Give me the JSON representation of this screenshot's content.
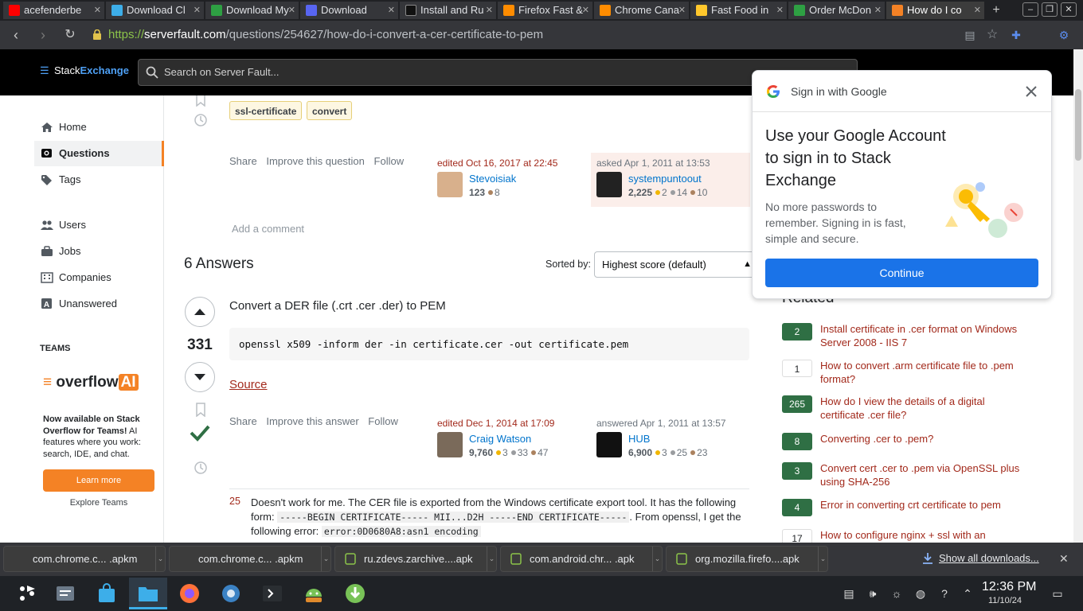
{
  "browser": {
    "tabs": [
      {
        "label": "acefenderbe",
        "color": "#ff0000"
      },
      {
        "label": "Download Cl",
        "color": "#3daee9"
      },
      {
        "label": "Download My",
        "color": "#2ea043"
      },
      {
        "label": "Download",
        "color": "#5865f2"
      },
      {
        "label": "Install and Ru",
        "color": "#111111"
      },
      {
        "label": "Firefox Fast &",
        "color": "#ff8c00"
      },
      {
        "label": "Chrome Cana",
        "color": "#ff8c00"
      },
      {
        "label": "Fast Food in",
        "color": "#ffc72c"
      },
      {
        "label": "Order McDon",
        "color": "#2ea043"
      },
      {
        "label": "How do I co",
        "color": "#f48225"
      }
    ],
    "url_scheme": "https://",
    "url_host": "serverfault.com",
    "url_path": "/questions/254627/how-do-i-convert-a-cer-certificate-to-pem"
  },
  "se_header": {
    "logo_stack": "Stack",
    "logo_exchange": "Exchange",
    "search_placeholder": "Search on Server Fault..."
  },
  "sidebar": {
    "items": [
      {
        "label": "Home",
        "icon": "home-icon"
      },
      {
        "label": "Questions",
        "icon": "questions-icon",
        "active": true
      },
      {
        "label": "Tags",
        "icon": "tag-icon"
      },
      {
        "label": "Users",
        "icon": "users-icon"
      },
      {
        "label": "Jobs",
        "icon": "briefcase-icon"
      },
      {
        "label": "Companies",
        "icon": "companies-icon"
      },
      {
        "label": "Unanswered",
        "icon": "unanswered-icon"
      }
    ],
    "teams_label": "TEAMS",
    "overflow_ai": {
      "text": "overflow",
      "ai": "AI"
    },
    "promo_bold": "Now available on Stack Overflow for Teams!",
    "promo_rest": " AI features where you work: search, IDE, and chat.",
    "learn_more": "Learn more",
    "explore_teams": "Explore Teams"
  },
  "question": {
    "tags": [
      "ssl-certificate",
      "convert"
    ],
    "menu": [
      "Share",
      "Improve this question",
      "Follow"
    ],
    "editor": {
      "action": "edited Oct 16, 2017 at 22:45",
      "name": "Stevoisiak",
      "rep": "123",
      "bronze": "8"
    },
    "owner": {
      "action": "asked Apr 1, 2011 at 13:53",
      "name": "systempuntoout",
      "rep": "2,225",
      "gold": "2",
      "silver": "14",
      "bronze": "10"
    },
    "add_comment": "Add a comment"
  },
  "answers": {
    "heading": "6 Answers",
    "sorted_by_label": "Sorted by:",
    "sort_value": "Highest score (default)",
    "top": {
      "score": "331",
      "title": "Convert a DER file (.crt .cer .der) to PEM",
      "code": "openssl x509 -inform der -in certificate.cer -out certificate.pem",
      "source_link": "Source",
      "menu": [
        "Share",
        "Improve this answer",
        "Follow"
      ],
      "editor": {
        "action": "edited Dec 1, 2014 at 17:09",
        "name": "Craig Watson",
        "rep": "9,760",
        "gold": "3",
        "silver": "33",
        "bronze": "47"
      },
      "answerer": {
        "action": "answered Apr 1, 2011 at 13:57",
        "name": "HUB",
        "rep": "6,900",
        "gold": "3",
        "silver": "25",
        "bronze": "23"
      },
      "comment": {
        "score": "25",
        "text1": "Doesn't work for me. The CER file is exported from the Windows certificate export tool. It has the following form: ",
        "code1": "-----BEGIN CERTIFICATE----- MII...D2H -----END CERTIFICATE-----",
        "text2": ". From openssl, I get the following error: ",
        "code2": "error:0D0680A8:asn1 encoding"
      }
    }
  },
  "related": {
    "heading": "Related",
    "items": [
      {
        "score": "2",
        "accepted": true,
        "title": "Install certificate in .cer format on Windows Server 2008 - IIS 7"
      },
      {
        "score": "1",
        "accepted": false,
        "title": "How to convert .arm certificate file to .pem format?"
      },
      {
        "score": "265",
        "accepted": true,
        "title": "How do I view the details of a digital certificate .cer file?"
      },
      {
        "score": "8",
        "accepted": true,
        "title": "Converting .cer to .pem?"
      },
      {
        "score": "3",
        "accepted": true,
        "title": "Convert cert .cer to .pem via OpenSSL plus using SHA-256"
      },
      {
        "score": "4",
        "accepted": true,
        "title": "Error in converting crt certificate to pem"
      },
      {
        "score": "17",
        "accepted": false,
        "title": "How to configure nginx + ssl with an"
      }
    ]
  },
  "google_popup": {
    "header": "Sign in with Google",
    "headline": "Use your Google Account to sign in to Stack Exchange",
    "body": "No more passwords to remember. Signing in is fast, simple and secure.",
    "continue": "Continue"
  },
  "downloads": {
    "items": [
      {
        "name": "com.chrome.c... .apkm"
      },
      {
        "name": "com.chrome.c... .apkm"
      },
      {
        "name": "ru.zdevs.zarchive....apk"
      },
      {
        "name": "com.android.chr... .apk"
      },
      {
        "name": "org.mozilla.firefo....apk"
      }
    ],
    "show_all": "Show all downloads..."
  },
  "taskbar": {
    "time": "12:36 PM",
    "date": "11/10/24"
  },
  "colors": {
    "accent_orange": "#f48225",
    "link_red": "#a2291b",
    "google_blue": "#1a73e8",
    "accepted_green": "#2f6f44"
  }
}
